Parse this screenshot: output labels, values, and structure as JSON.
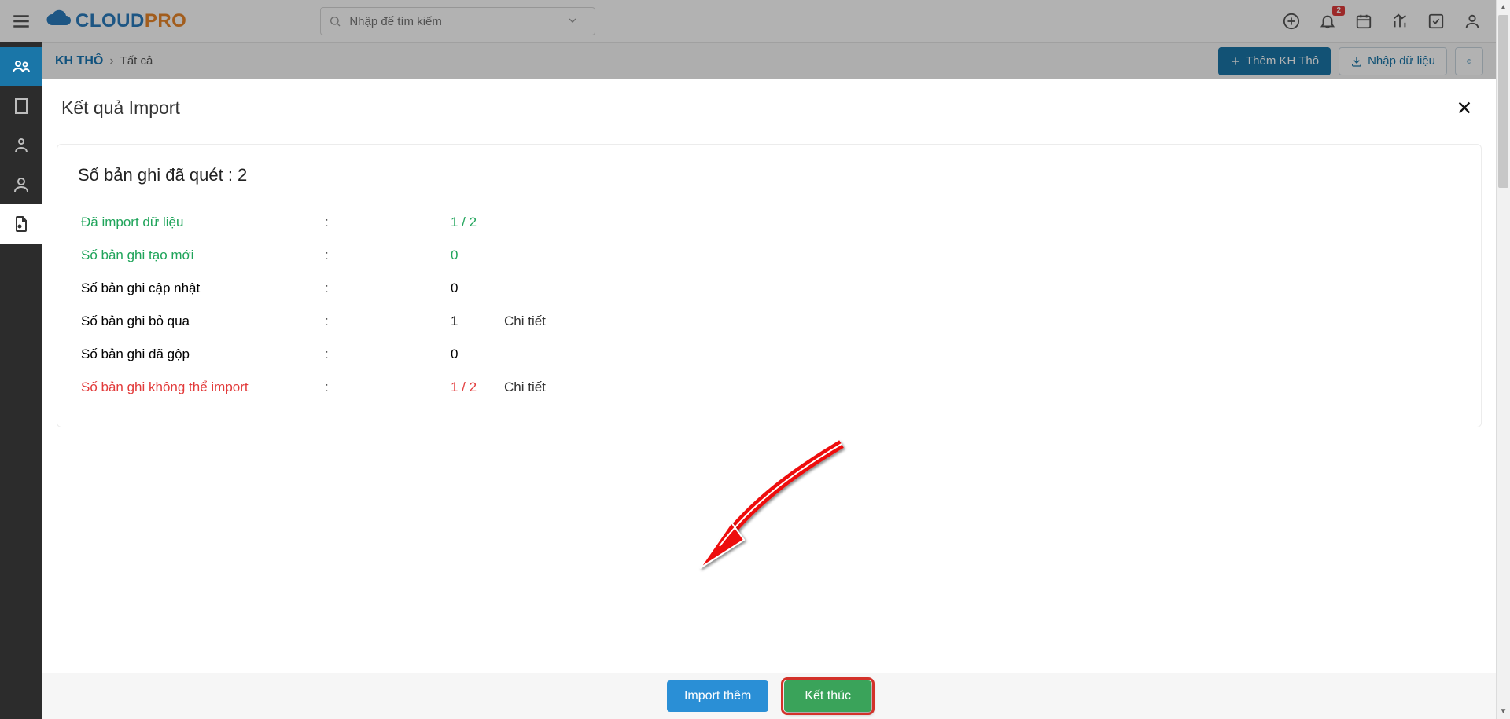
{
  "header": {
    "logo_main": "CLOUD",
    "logo_accent": "PRO",
    "search_placeholder": "Nhập để tìm kiếm",
    "notif_badge": "2"
  },
  "subheader": {
    "title": "KH THÔ",
    "current": "Tất cả",
    "add_label": "Thêm KH Thô",
    "import_label": "Nhập dữ liệu"
  },
  "modal": {
    "title": "Kết quả Import",
    "scanned_label": "Số bản ghi đã quét  :  2",
    "rows": {
      "imported": {
        "label": "Đã import dữ liệu",
        "value": "1 / 2",
        "detail": ""
      },
      "created": {
        "label": "Số bản ghi tạo mới",
        "value": "0",
        "detail": ""
      },
      "updated": {
        "label": "Số bản ghi cập nhật",
        "value": "0",
        "detail": ""
      },
      "skipped": {
        "label": "Số bản ghi bỏ qua",
        "value": "1",
        "detail": "Chi tiết"
      },
      "merged": {
        "label": "Số bản ghi đã gộp",
        "value": "0",
        "detail": ""
      },
      "failed": {
        "label": "Số bản ghi không thể import",
        "value": "1 / 2",
        "detail": "Chi tiết"
      }
    },
    "footer": {
      "more": "Import thêm",
      "finish": "Kết thúc"
    }
  }
}
